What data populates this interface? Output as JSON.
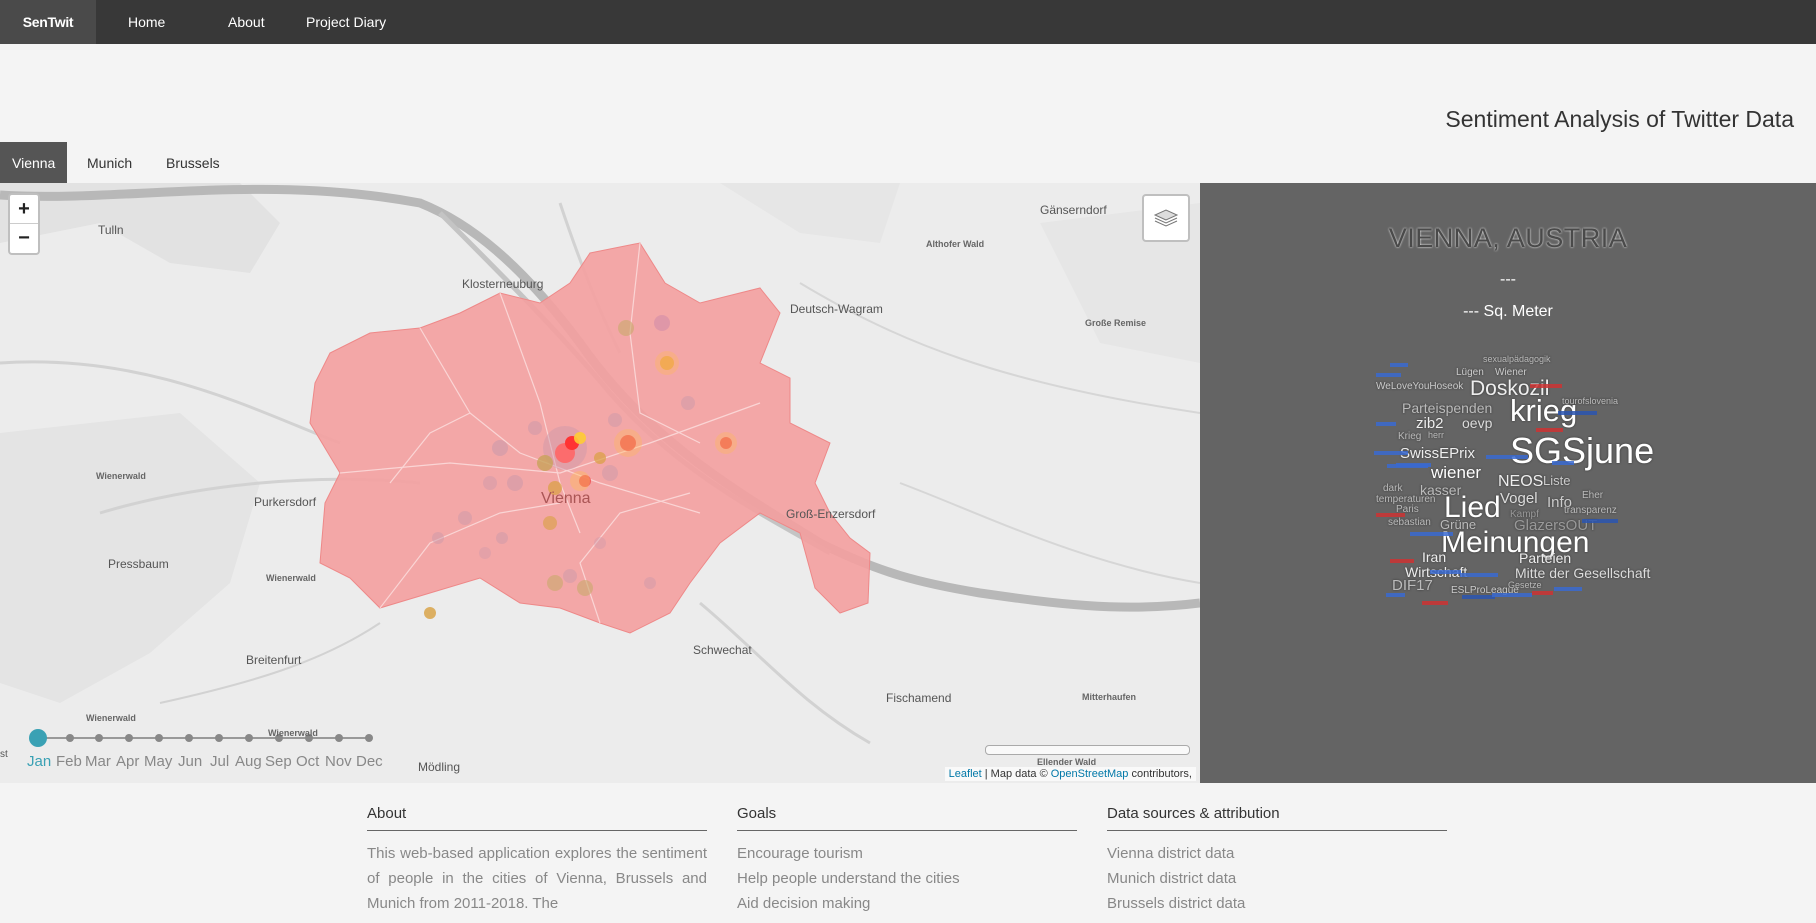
{
  "nav": {
    "brand": "SenTwit",
    "links": [
      "Home",
      "About",
      "Project Diary"
    ]
  },
  "title": "Sentiment Analysis of Twitter Data",
  "tabs": [
    "Vienna",
    "Munich",
    "Brussels"
  ],
  "map": {
    "zoom_in": "+",
    "zoom_out": "−",
    "places": [
      "Tulln",
      "Gänserndorf",
      "Althofer Wald",
      "Klosterneuburg",
      "Deutsch-Wagram",
      "Große Remise",
      "Wienerwald",
      "Purkersdorf",
      "Vienna",
      "Groß-Enzersdorf",
      "Pressbaum",
      "Wienerwald",
      "Breitenfurt",
      "Schwechat",
      "Fischamend",
      "Mitterhaufen",
      "Wienerwald",
      "Wienerwald",
      "Mödling",
      "Ellender Wald",
      "st"
    ],
    "months": [
      "Jan",
      "Feb",
      "Mar",
      "Apr",
      "May",
      "Jun",
      "Jul",
      "Aug",
      "Sep",
      "Oct",
      "Nov",
      "Dec"
    ],
    "selected_month": "Jan",
    "attribution": {
      "leaflet": "Leaflet",
      "text1": " | Map data © ",
      "osm": "OpenStreetMap",
      "text2": " contributors,"
    },
    "colors": {
      "district_fill": "#f4a0a0",
      "accent": "#3aa1b4"
    }
  },
  "panel": {
    "city": "VIENNA, AUSTRIA",
    "population": "---",
    "area": "--- Sq. Meter"
  },
  "wordcloud": [
    {
      "t": "sexualpädagogik",
      "c": "#bbb"
    },
    {
      "t": "Lügen",
      "c": "#ccc"
    },
    {
      "t": "Wiener",
      "c": "#ccc"
    },
    {
      "t": "WeLoveYouHoseok",
      "c": "#ccc"
    },
    {
      "t": "Doskozil",
      "c": "#eee"
    },
    {
      "t": "Parteispenden",
      "c": "#bbb"
    },
    {
      "t": "krieg",
      "c": "#fff"
    },
    {
      "t": "tourofslovenia",
      "c": "#bbb"
    },
    {
      "t": "zib2",
      "c": "#eee"
    },
    {
      "t": "oevp",
      "c": "#ddd"
    },
    {
      "t": "Krieg",
      "c": "#bbb"
    },
    {
      "t": "herr",
      "c": "#bbb"
    },
    {
      "t": "SGSjune",
      "c": "#fff"
    },
    {
      "t": "SwissEPrix",
      "c": "#eee"
    },
    {
      "t": "wiener",
      "c": "#fff"
    },
    {
      "t": "NEOS",
      "c": "#eee"
    },
    {
      "t": "Liste",
      "c": "#ccc"
    },
    {
      "t": "dark",
      "c": "#bbb"
    },
    {
      "t": "kasser",
      "c": "#bbb"
    },
    {
      "t": "temperaturen",
      "c": "#bbb"
    },
    {
      "t": "Lied",
      "c": "#fff"
    },
    {
      "t": "Vogel",
      "c": "#ddd"
    },
    {
      "t": "Info",
      "c": "#ccc"
    },
    {
      "t": "Eher",
      "c": "#bbb"
    },
    {
      "t": "transparenz",
      "c": "#bbb"
    },
    {
      "t": "Paris",
      "c": "#bbb"
    },
    {
      "t": "Kampf",
      "c": "#999"
    },
    {
      "t": "sebastian",
      "c": "#bbb"
    },
    {
      "t": "Grüne",
      "c": "#bbb"
    },
    {
      "t": "GlazersOUT",
      "c": "#999"
    },
    {
      "t": "Meinungen",
      "c": "#fff"
    },
    {
      "t": "Iran",
      "c": "#eee"
    },
    {
      "t": "Parteien",
      "c": "#eee"
    },
    {
      "t": "Wirtschaft",
      "c": "#eee"
    },
    {
      "t": "Mitte der Gesellschaft",
      "c": "#ddd"
    },
    {
      "t": "DIF17",
      "c": "#bbb"
    },
    {
      "t": "ESLProLeague",
      "c": "#ccc"
    },
    {
      "t": "Gesetze",
      "c": "#bbb"
    }
  ],
  "footer": [
    {
      "head": "About",
      "text": "This web-based application explores the sentiment of people in the cities of Vienna, Brussels and Munich from 2011-2018. The"
    },
    {
      "head": "Goals",
      "items": [
        "Encourage tourism",
        "Help people understand the cities",
        "Aid decision making"
      ]
    },
    {
      "head": "Data sources & attribution",
      "items": [
        "Vienna district data",
        "Munich district data",
        "Brussels district data"
      ]
    }
  ]
}
